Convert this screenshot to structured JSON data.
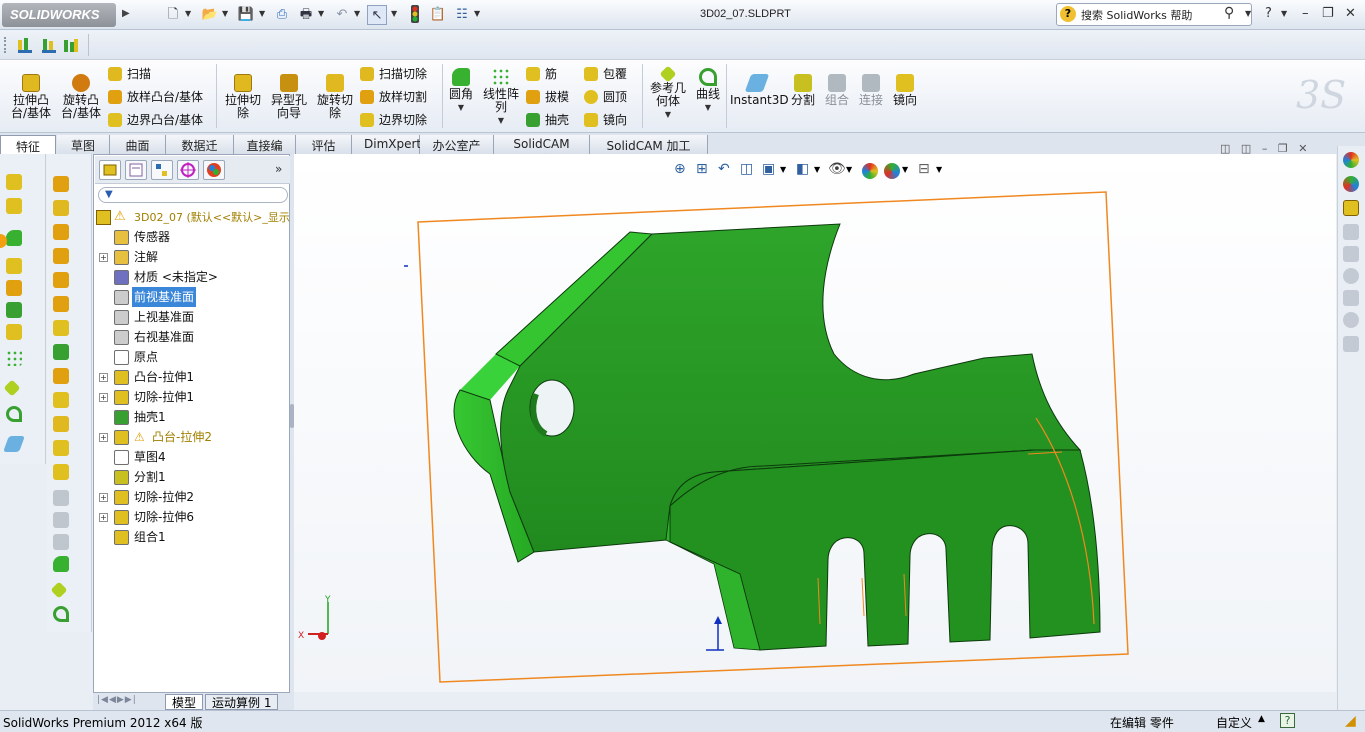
{
  "app": {
    "logo_text": "SOLIDWORKS",
    "filename": "3D02_07.SLDPRT",
    "search_placeholder": "搜索 SolidWorks 帮助",
    "help_glyph": "?"
  },
  "ribbon": {
    "features": [
      {
        "label": "拉伸凸\n台/基体",
        "color": "#e0b820"
      },
      {
        "label": "旋转凸\n台/基体",
        "color": "#d07a10"
      }
    ],
    "small_group1": [
      "扫描",
      "放样凸台/基体",
      "边界凸台/基体"
    ],
    "features2": [
      {
        "label": "拉伸切\n除",
        "color": "#e0b820"
      },
      {
        "label": "异型孔\n向导",
        "color": "#c89010"
      },
      {
        "label": "旋转切\n除",
        "color": "#e0b820"
      }
    ],
    "small_group2": [
      "扫描切除",
      "放样切割",
      "边界切除"
    ],
    "features3": [
      {
        "label": "圆角",
        "color": "#38b030"
      },
      {
        "label": "线性阵\n列",
        "color": "#38b030"
      }
    ],
    "small_group3": [
      "筋",
      "拔模",
      "抽壳"
    ],
    "small_group4": [
      "包覆",
      "圆顶",
      "镜向"
    ],
    "features4": [
      {
        "label": "参考几\n何体",
        "color": "#b0d020"
      },
      {
        "label": "曲线",
        "color": "#38a030"
      }
    ],
    "features5": [
      {
        "label": "Instant3D",
        "color": "#6ab0e0"
      },
      {
        "label": "分割",
        "color": "#c8c020"
      },
      {
        "label": "组合",
        "color": "#b0b8c0"
      },
      {
        "label": "连接",
        "color": "#b0b8c0"
      },
      {
        "label": "镜向",
        "color": "#e0c020"
      }
    ]
  },
  "tabs": [
    "特征",
    "草图",
    "曲面",
    "数据迁移",
    "直接编辑",
    "评估",
    "DimXpert",
    "办公室产品",
    "SolidCAM 工件",
    "SolidCAM 加工工程"
  ],
  "tree": {
    "root": "3D02_07  (默认<<默认>_显示",
    "items": [
      {
        "label": "传感器",
        "exp": false,
        "color": "#e8c040"
      },
      {
        "label": "注解",
        "exp": true,
        "color": "#e8c040"
      },
      {
        "label": "材质 <未指定>",
        "exp": false,
        "color": "#7070c0"
      },
      {
        "label": "前视基准面",
        "exp": false,
        "color": "#cccccc",
        "selected": true
      },
      {
        "label": "上视基准面",
        "exp": false,
        "color": "#cccccc"
      },
      {
        "label": "右视基准面",
        "exp": false,
        "color": "#cccccc"
      },
      {
        "label": "原点",
        "exp": false,
        "color": "#ffffff"
      },
      {
        "label": "凸台-拉伸1",
        "exp": true,
        "color": "#e0c020"
      },
      {
        "label": "切除-拉伸1",
        "exp": true,
        "color": "#e0c020"
      },
      {
        "label": "抽壳1",
        "exp": false,
        "color": "#38a030"
      },
      {
        "label": "凸台-拉伸2",
        "exp": true,
        "color": "#e0c020",
        "warning": true
      },
      {
        "label": "草图4",
        "exp": false,
        "color": "#ffffff"
      },
      {
        "label": "分割1",
        "exp": false,
        "color": "#c8c020"
      },
      {
        "label": "切除-拉伸2",
        "exp": true,
        "color": "#e0c020"
      },
      {
        "label": "切除-拉伸6",
        "exp": true,
        "color": "#e0c020"
      },
      {
        "label": "组合1",
        "exp": false,
        "color": "#e0c020"
      }
    ],
    "bottom_tabs": [
      "模型",
      "运动算例 1"
    ]
  },
  "status": {
    "left": "SolidWorks Premium 2012 x64 版",
    "editing": "在编辑 零件",
    "custom": "自定义"
  },
  "axes": {
    "x": "X",
    "y": "Y"
  }
}
